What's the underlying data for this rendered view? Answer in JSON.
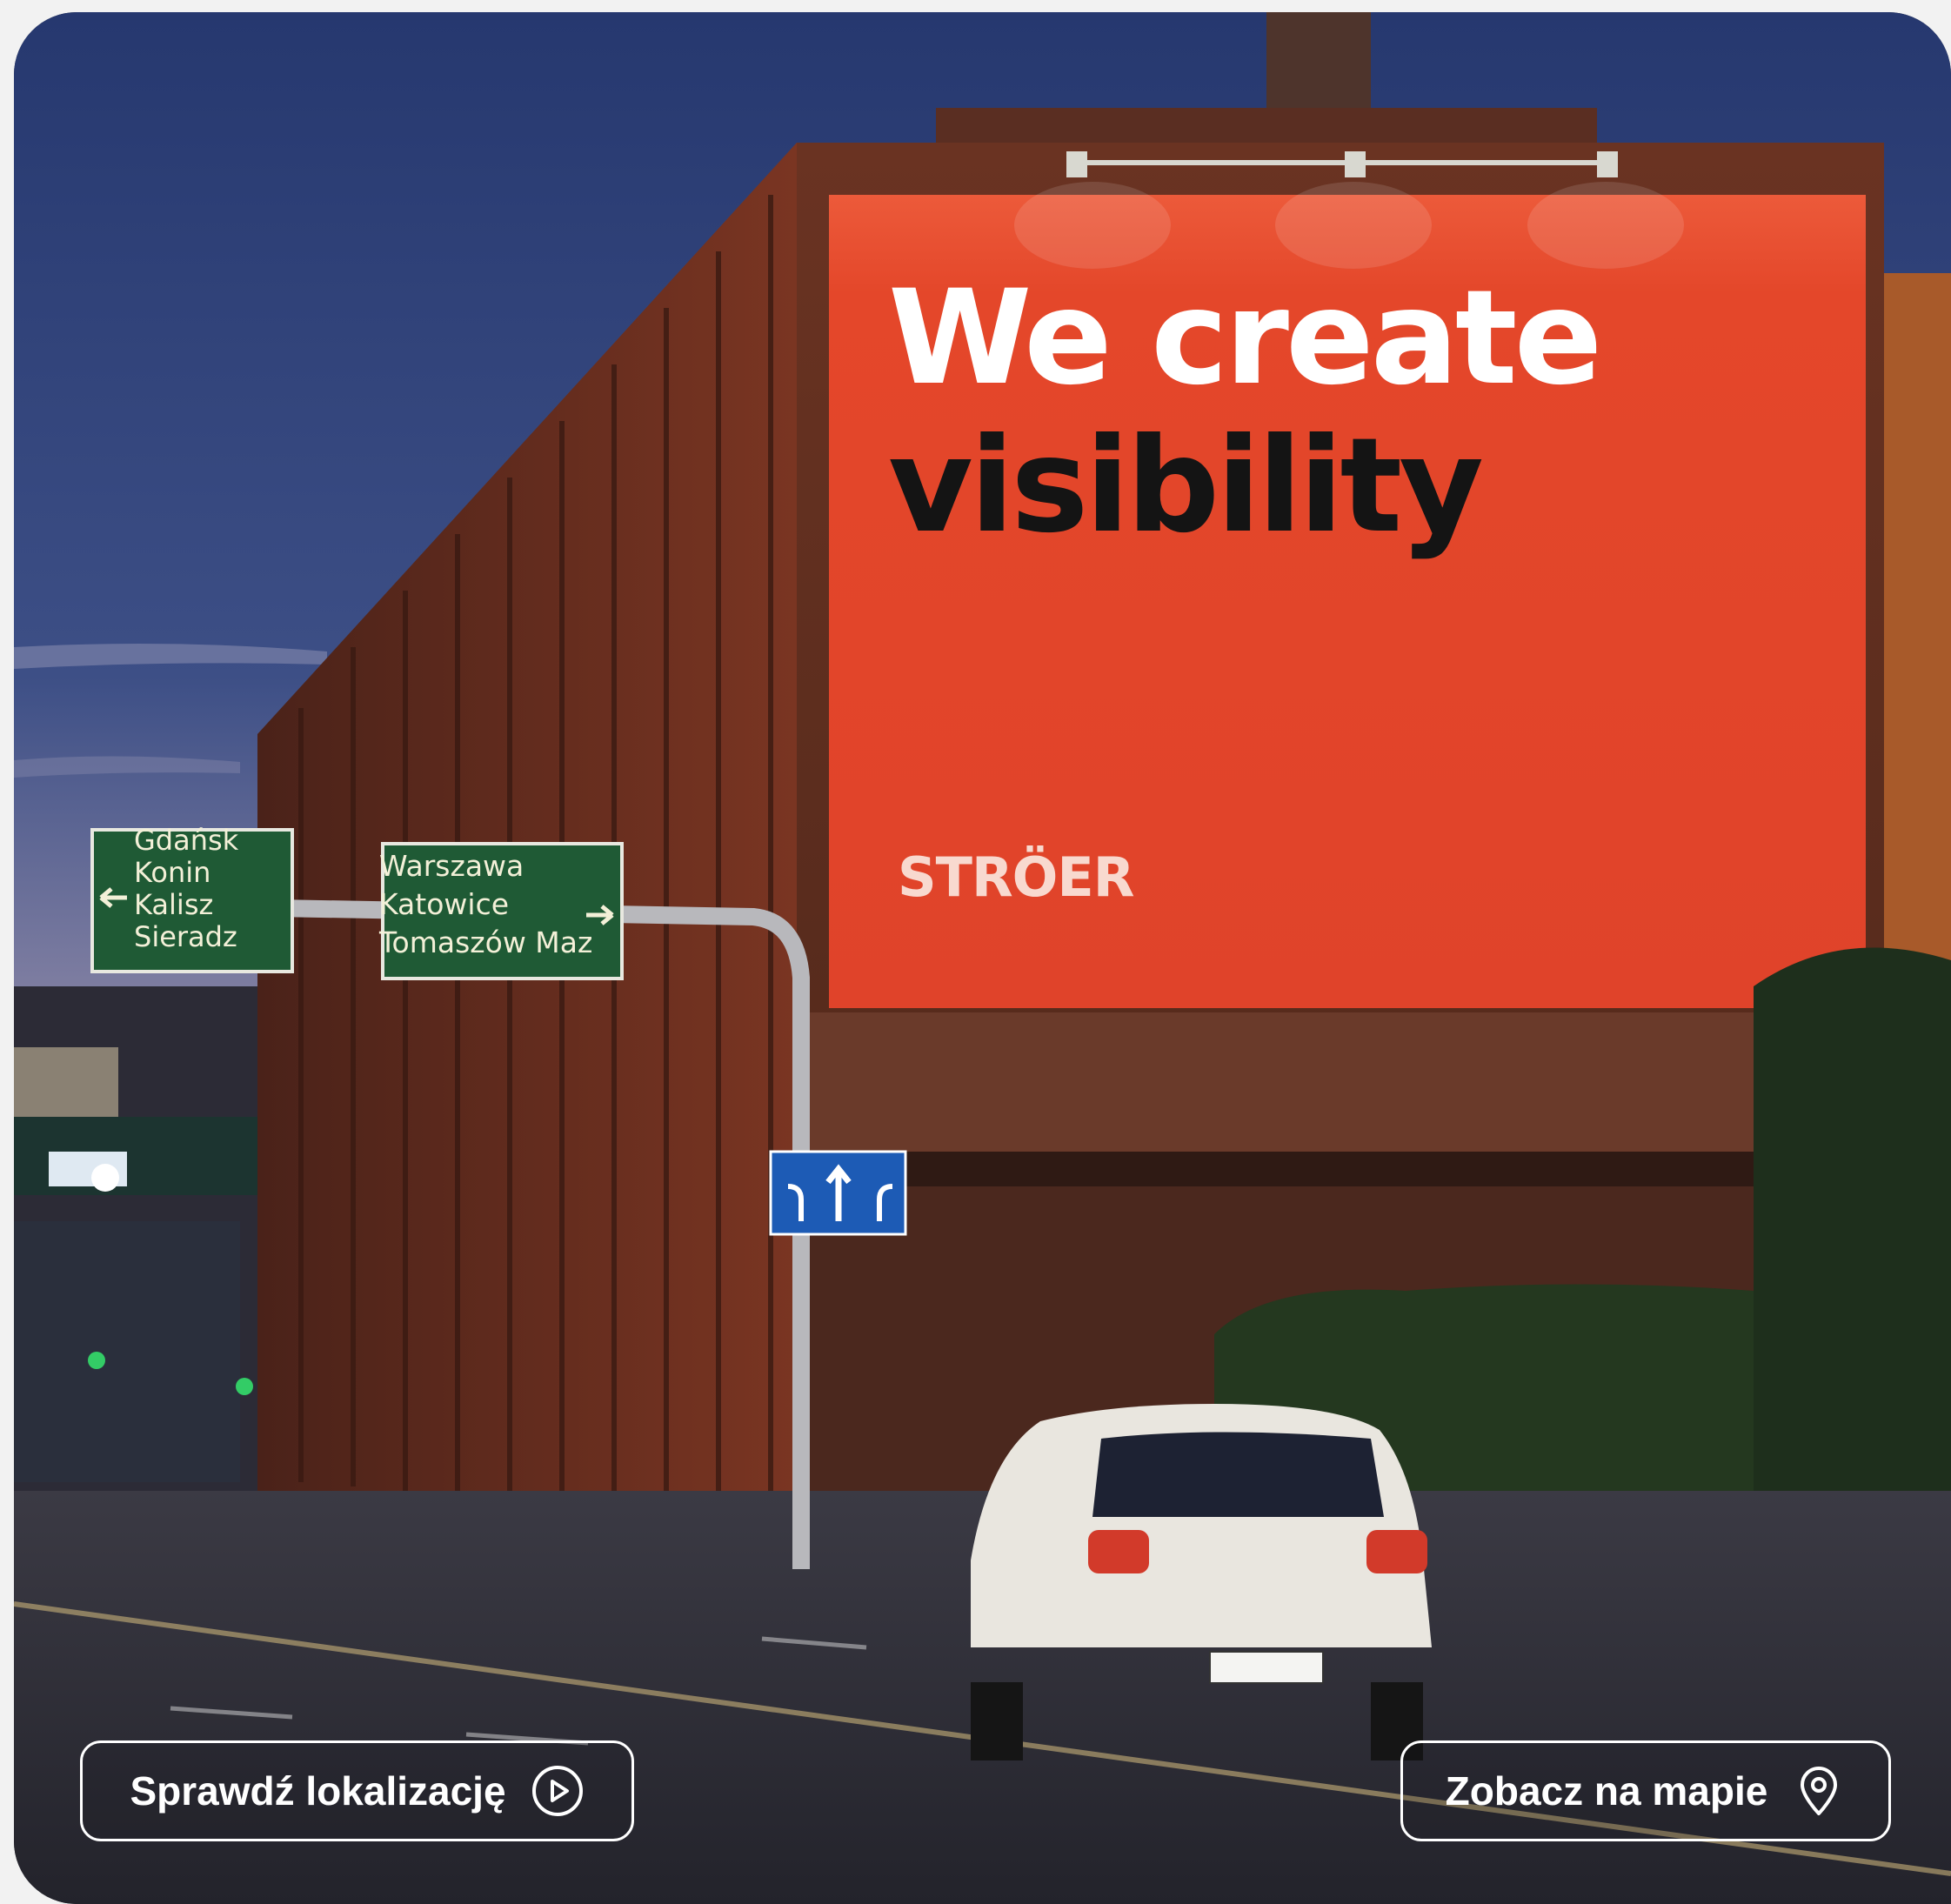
{
  "billboard": {
    "headline_line1": "We create",
    "headline_line2": "visibility",
    "brand": "STRÖER"
  },
  "road_signs": {
    "left": [
      "Gdańsk",
      "Konin",
      "Kalisz",
      "Sieradz"
    ],
    "right": [
      "Warszawa",
      "Katowice",
      "Tomaszów Maz"
    ]
  },
  "actions": {
    "check_location_label": "Sprawdź lokalizację",
    "check_location_icon": "play-circle-icon",
    "see_on_map_label": "Zobacz na mapie",
    "see_on_map_icon": "map-pin-icon"
  },
  "colors": {
    "billboard": "#e4472a",
    "sky_top": "#2f3f7a",
    "brick": "#6e2f1f",
    "road_sign": "#1f5a35"
  }
}
